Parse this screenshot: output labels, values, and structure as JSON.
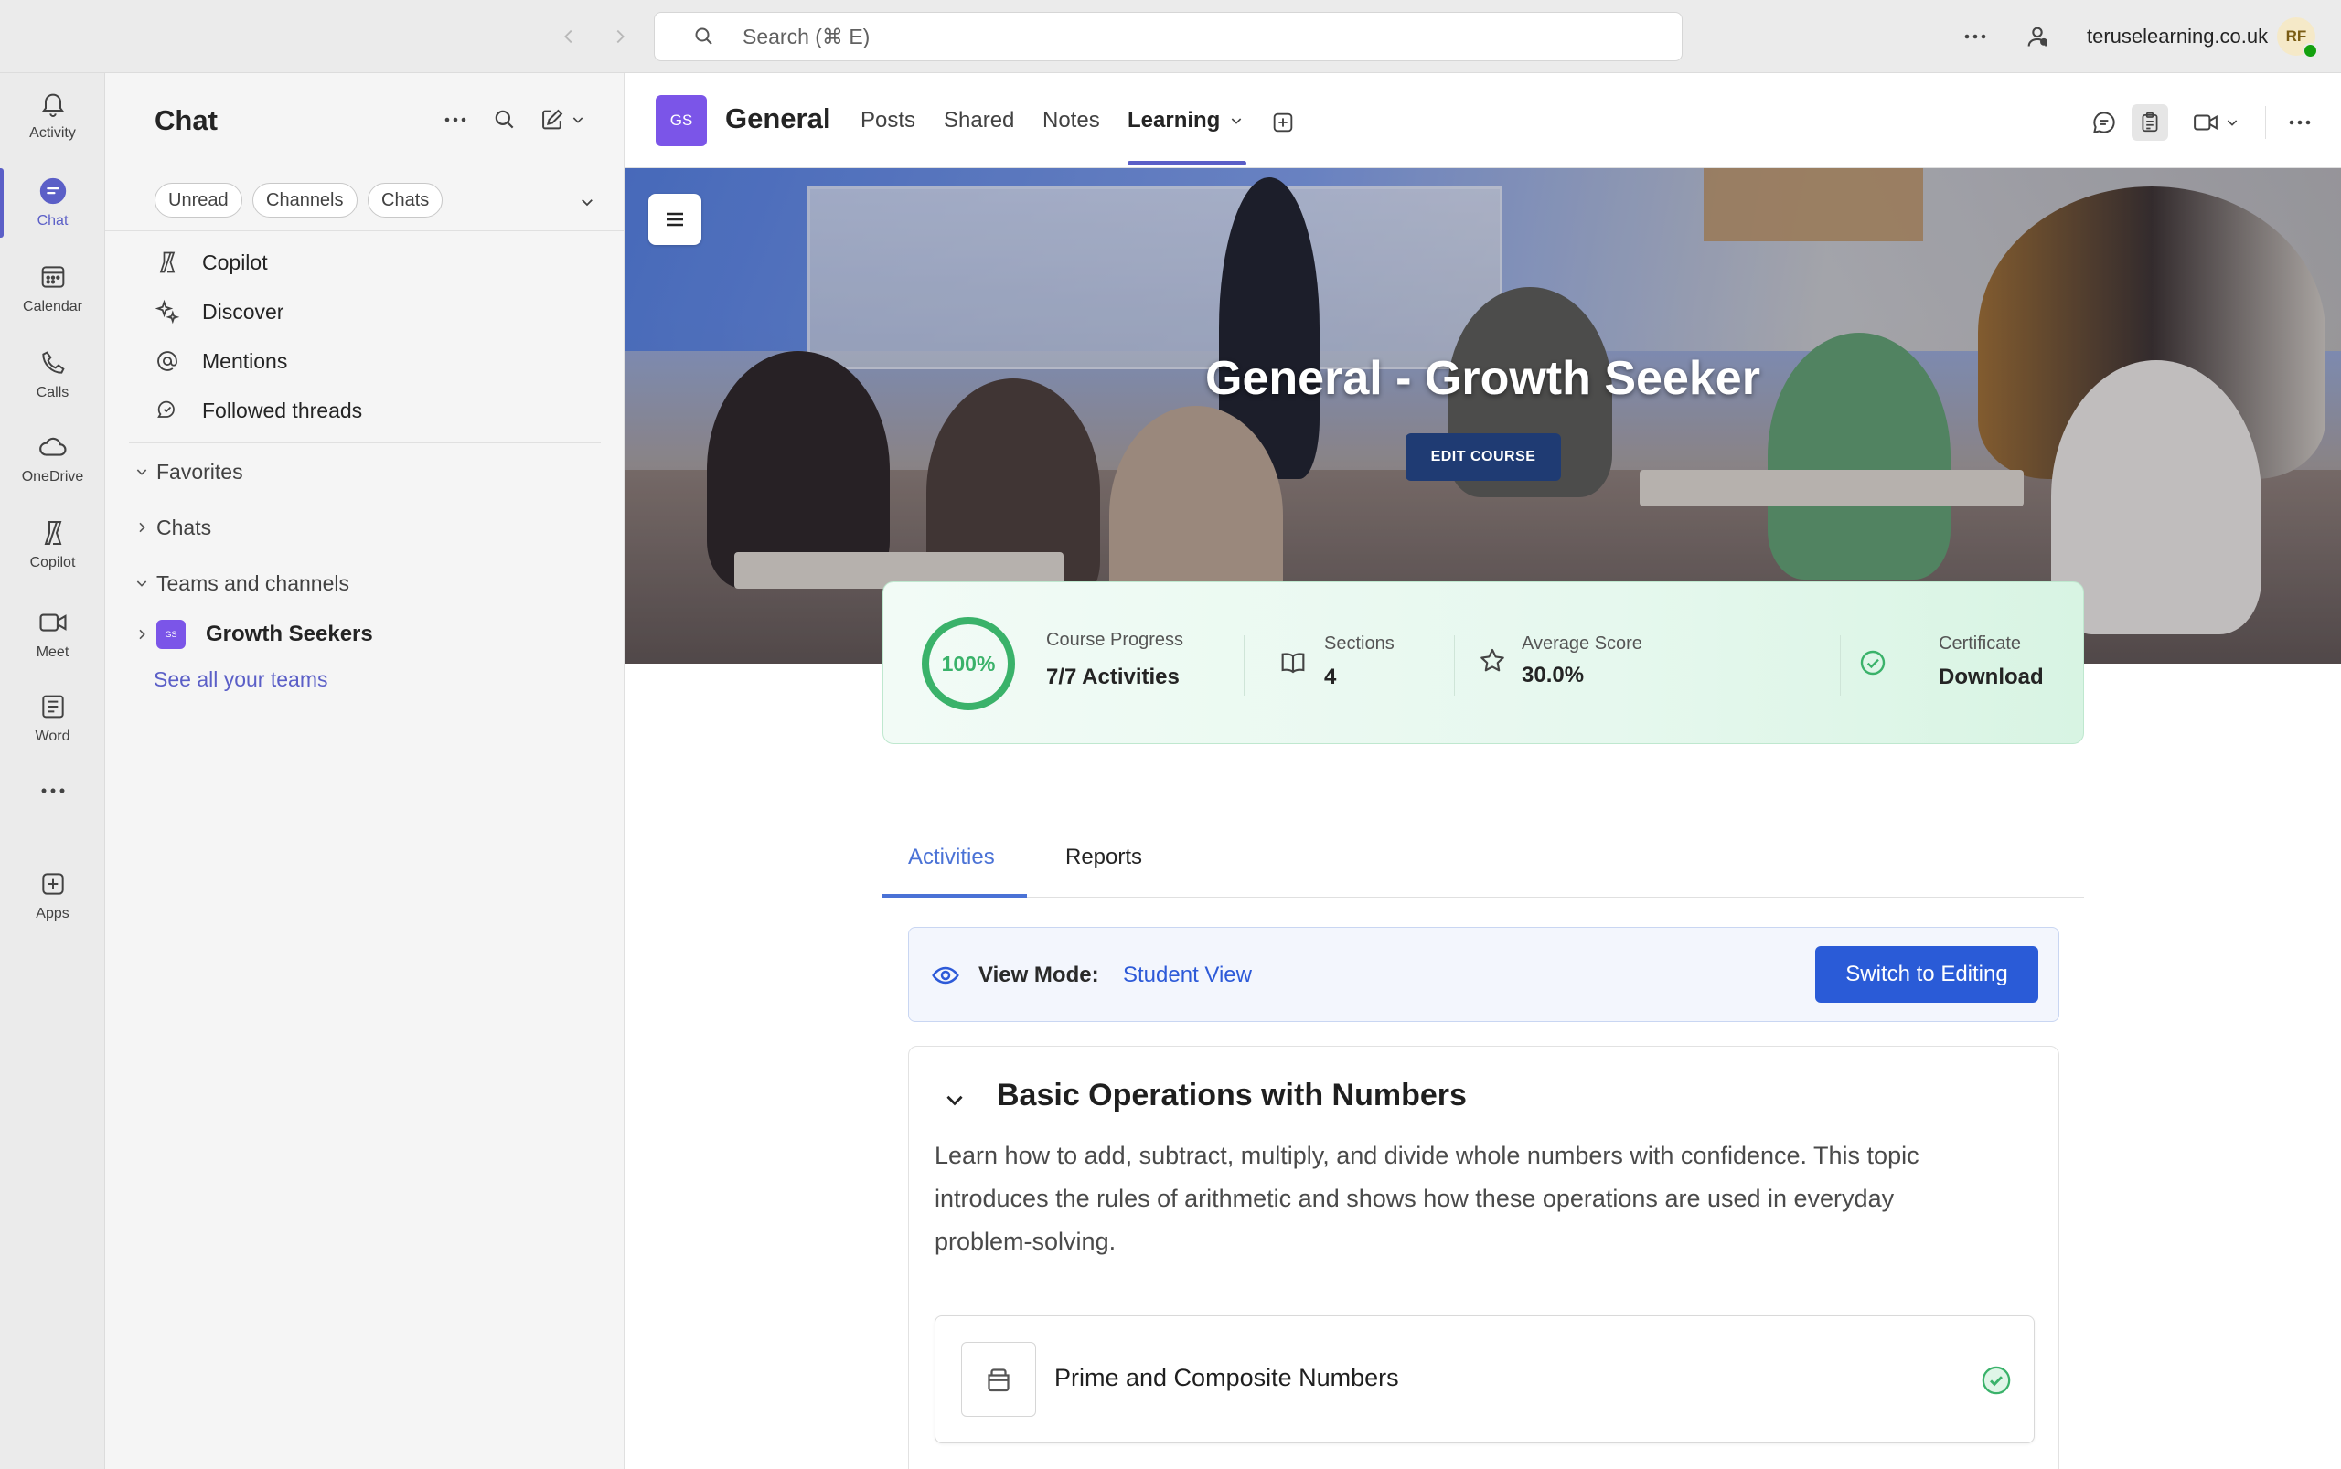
{
  "topbar": {
    "search_placeholder": "Search (⌘ E)",
    "org_name": "teruselearning.co.uk",
    "avatar_initials": "RF"
  },
  "rail": {
    "items": [
      {
        "label": "Activity",
        "icon": "bell-icon"
      },
      {
        "label": "Chat",
        "icon": "chat-icon",
        "active": true
      },
      {
        "label": "Calendar",
        "icon": "calendar-icon"
      },
      {
        "label": "Calls",
        "icon": "phone-icon"
      },
      {
        "label": "OneDrive",
        "icon": "cloud-icon"
      },
      {
        "label": "Copilot",
        "icon": "copilot-icon"
      },
      {
        "label": "Meet",
        "icon": "video-icon"
      },
      {
        "label": "Word",
        "icon": "word-icon"
      },
      {
        "label": "",
        "icon": "more-horizontal-icon"
      },
      {
        "label": "Apps",
        "icon": "plus-square-icon"
      }
    ]
  },
  "chat_panel": {
    "title": "Chat",
    "filters": [
      "Unread",
      "Channels",
      "Chats"
    ],
    "quick_links": [
      {
        "label": "Copilot",
        "icon": "copilot-icon"
      },
      {
        "label": "Discover",
        "icon": "sparkle-icon"
      },
      {
        "label": "Mentions",
        "icon": "at-icon"
      },
      {
        "label": "Followed threads",
        "icon": "threads-icon"
      }
    ],
    "sections": {
      "favorites": "Favorites",
      "chats": "Chats",
      "teams": "Teams and channels"
    },
    "team": {
      "badge": "GS",
      "name": "Growth Seekers"
    },
    "see_all": "See all your teams"
  },
  "channel": {
    "badge": "GS",
    "name": "General",
    "tabs": [
      "Posts",
      "Shared",
      "Notes",
      "Learning"
    ],
    "active_tab": "Learning"
  },
  "course": {
    "title": "General - Growth Seeker",
    "edit_label": "EDIT COURSE",
    "stats": {
      "progress_pct_label": "100%",
      "progress_fraction": 1.0,
      "progress_label": "Course Progress",
      "progress_value": "7/7 Activities",
      "sections_label": "Sections",
      "sections_value": "4",
      "score_label": "Average Score",
      "score_value": "30.0%",
      "cert_label": "Certificate",
      "cert_value": "Download"
    },
    "tabs": [
      "Activities",
      "Reports"
    ],
    "active_tab": "Activities",
    "view_mode": {
      "label": "View Mode:",
      "value": "Student View",
      "switch_label": "Switch to Editing"
    },
    "section": {
      "title": "Basic Operations with Numbers",
      "description": "Learn how to add, subtract, multiply, and divide whole numbers with confidence. This topic introduces the rules of arithmetic and shows how these operations are used in everyday problem-solving.",
      "activities": [
        {
          "title": "Prime and Composite Numbers",
          "completed": true
        }
      ]
    }
  },
  "colors": {
    "accent": "#5b5fc7",
    "team_badge": "#7b55e8",
    "progress": "#3ab26a",
    "primary_button": "#2a5bd7",
    "edit_button": "#1f3b73"
  }
}
